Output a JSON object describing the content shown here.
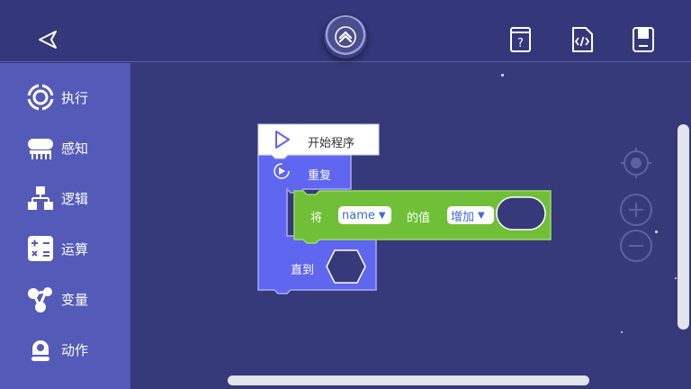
{
  "sidebar": {
    "items": [
      {
        "label": "执行",
        "icon": "execute-icon"
      },
      {
        "label": "感知",
        "icon": "sense-icon"
      },
      {
        "label": "逻辑",
        "icon": "logic-icon"
      },
      {
        "label": "运算",
        "icon": "calculate-icon"
      },
      {
        "label": "变量",
        "icon": "variable-icon"
      },
      {
        "label": "动作",
        "icon": "action-icon"
      }
    ]
  },
  "toolbar": {
    "back_icon": "back-arrow-icon",
    "home_icon": "chevron-up-icon",
    "help_icon": "help-book-icon",
    "code_icon": "code-file-icon",
    "save_icon": "save-icon"
  },
  "blocks": {
    "start_label": "开始程序",
    "repeat_label": "重复",
    "set_prefix": "将",
    "var_name": "name",
    "value_of": "的值",
    "op": "增加",
    "until_label": "直到"
  },
  "colors": {
    "background": "#363a7a",
    "sidebar": "#545ab7",
    "loop_block": "#5f66ef",
    "variable_block": "#6fc037",
    "start_block": "#ffffff"
  }
}
